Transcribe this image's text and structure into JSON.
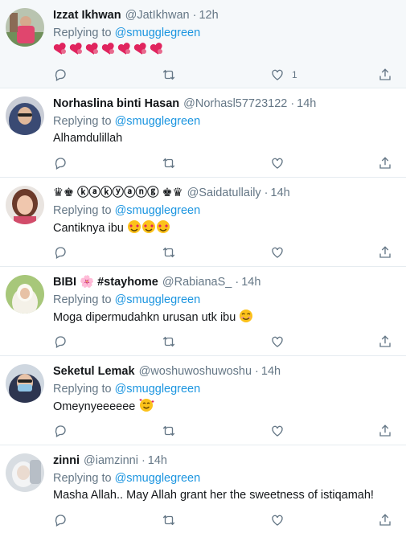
{
  "replying_label": "Replying to",
  "mention": "@smugglegreen",
  "tweets": [
    {
      "name": "Izzat Ikhwan",
      "handle": "@JatIkhwan",
      "time": "12h",
      "text": "",
      "emoji_type": "hearts",
      "like_count": "1",
      "avatar_color": "#c9a89a"
    },
    {
      "name": "Norhaslina binti Hasan",
      "handle": "@Norhasl57723122",
      "time": "14h",
      "text": "Alhamdulillah",
      "emoji_type": "",
      "like_count": "",
      "avatar_color": "#5b6a8a"
    },
    {
      "name": "♛♚ ⓚⓐⓚⓨⓐⓝⓖ ♚♛",
      "handle": "@Saidatullaily",
      "time": "14h",
      "text": "Cantiknya ibu",
      "emoji_type": "heart-eyes",
      "like_count": "",
      "avatar_color": "#d98b8b"
    },
    {
      "name": "BIBI 🌸 #stayhome",
      "handle": "@RabianaS_",
      "time": "14h",
      "text": "Moga dipermudahkn urusan utk ibu",
      "emoji_type": "smile",
      "like_count": "",
      "avatar_color": "#9bbf6b"
    },
    {
      "name": "Seketul Lemak",
      "handle": "@woshuwoshuwoshu",
      "time": "14h",
      "text": "Omeynyeeeeee",
      "emoji_type": "love-face",
      "like_count": "",
      "avatar_color": "#3f4b66"
    },
    {
      "name": "zinni",
      "handle": "@iamzinni",
      "time": "14h",
      "text": "Masha Allah.. May Allah grant her the sweetness of istiqamah!",
      "emoji_type": "",
      "like_count": "",
      "avatar_color": "#c7ccd1"
    }
  ],
  "icons": {
    "reply": "reply-icon",
    "retweet": "retweet-icon",
    "like": "heart-icon",
    "share": "share-icon"
  },
  "colors": {
    "link": "#1b95e0",
    "muted": "#657786",
    "heart": "#e0245e"
  }
}
